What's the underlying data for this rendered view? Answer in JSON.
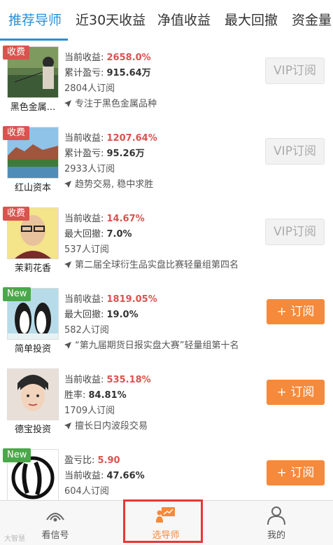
{
  "tabs": [
    {
      "label": "推荐导师",
      "active": true
    },
    {
      "label": "近30天收益",
      "active": false
    },
    {
      "label": "净值收益",
      "active": false
    },
    {
      "label": "最大回撤",
      "active": false
    },
    {
      "label": "资金量",
      "active": false
    }
  ],
  "colors": {
    "accent_blue": "#2a8fd6",
    "accent_orange": "#f58a3c",
    "profit_red": "#d9534f",
    "new_green": "#4aa84a"
  },
  "cards": [
    {
      "name": "黑色金属...",
      "badge": "收费",
      "badge_type": "fee",
      "line1_label": "当前收益: ",
      "line1_value": "2658.0%",
      "line2_label": "累计盈亏: ",
      "line2_value": "915.64万",
      "subscribers": "2804人订阅",
      "desc": "专注于黑色金属品种",
      "button": "VIP订阅",
      "button_type": "vip",
      "avatar": "fishing-photo"
    },
    {
      "name": "红山资本",
      "badge": "收费",
      "badge_type": "fee",
      "line1_label": "当前收益: ",
      "line1_value": "1207.64%",
      "line2_label": "累计盈亏: ",
      "line2_value": "95.26万",
      "subscribers": "2933人订阅",
      "desc": "趋势交易, 稳中求胜",
      "button": "VIP订阅",
      "button_type": "vip",
      "avatar": "landscape-photo"
    },
    {
      "name": "茉莉花香",
      "badge": "收费",
      "badge_type": "fee",
      "line1_label": "当前收益: ",
      "line1_value": "14.67%",
      "line2_label": "最大回撤: ",
      "line2_value": "7.0%",
      "subscribers": "537人订阅",
      "desc": "第二届全球衍生品实盘比赛轻量组第四名",
      "button": "VIP订阅",
      "button_type": "vip",
      "avatar": "man-portrait"
    },
    {
      "name": "简单投资",
      "badge": "New",
      "badge_type": "new",
      "line1_label": "当前收益: ",
      "line1_value": "1819.05%",
      "line2_label": "最大回撤: ",
      "line2_value": "19.0%",
      "subscribers": "582人订阅",
      "desc": "“第九届期货日报实盘大赛”轻量组第十名",
      "button": "+ 订阅",
      "button_type": "sub",
      "avatar": "penguins-photo"
    },
    {
      "name": "德宝投资",
      "badge": "",
      "badge_type": "",
      "line1_label": "当前收益: ",
      "line1_value": "535.18%",
      "line2_label": "胜率: ",
      "line2_value": "84.81%",
      "subscribers": "1709人订阅",
      "desc": "擅长日内波段交易",
      "button": "+ 订阅",
      "button_type": "sub",
      "avatar": "drawn-face"
    },
    {
      "name": "",
      "badge": "New",
      "badge_type": "new",
      "line1_label": "盈亏比: ",
      "line1_value": "5.90",
      "line2_label": "当前收益: ",
      "line2_value": "47.66%",
      "subscribers": "604人订阅",
      "desc": "",
      "button": "+ 订阅",
      "button_type": "sub",
      "avatar": "calligraphy-logo"
    }
  ],
  "bottom_nav": [
    {
      "label": "看信号",
      "icon": "signal-icon",
      "active": false
    },
    {
      "label": "选导师",
      "icon": "teacher-board-icon",
      "active": true
    },
    {
      "label": "我的",
      "icon": "user-icon",
      "active": false
    }
  ],
  "watermark": "大智慧"
}
